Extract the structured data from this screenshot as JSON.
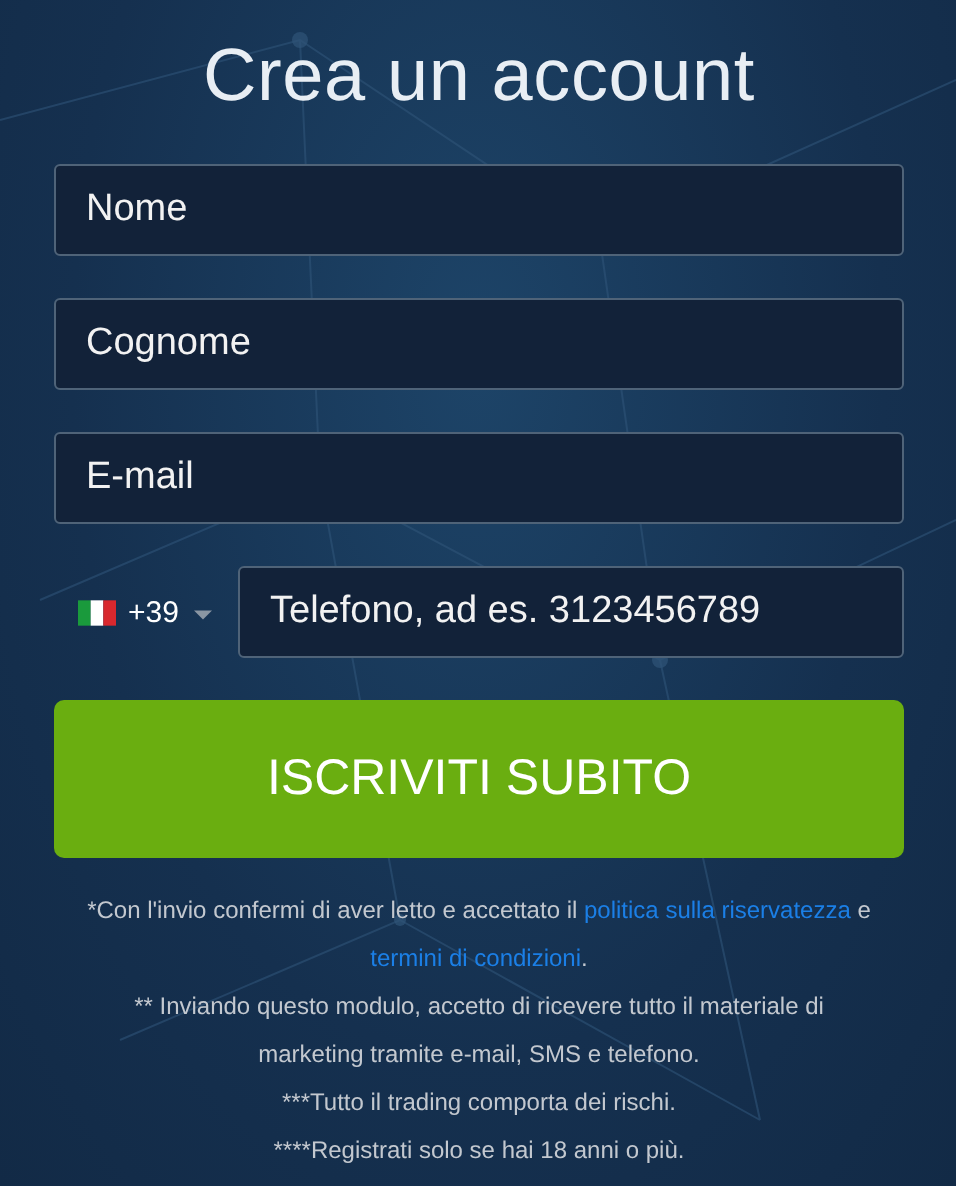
{
  "title": "Crea un account",
  "fields": [
    {
      "placeholder": "Nome"
    },
    {
      "placeholder": "Cognome"
    },
    {
      "placeholder": "E-mail"
    }
  ],
  "phone": {
    "country_code": "+39",
    "placeholder": "Telefono, ad es. 3123456789"
  },
  "submit_button": "ISCRIVITI SUBITO",
  "notes": [
    {
      "segments": [
        {
          "kind": "text",
          "text": "*Con l'invio confermi di aver letto e accettato il "
        },
        {
          "kind": "link",
          "text": "politica sulla riservatezza"
        },
        {
          "kind": "text",
          "text": " e "
        },
        {
          "kind": "link",
          "text": "termini di condizioni"
        },
        {
          "kind": "text",
          "text": "."
        }
      ]
    },
    {
      "segments": [
        {
          "kind": "text",
          "text": "** Inviando questo modulo, accetto di ricevere tutto il materiale di marketing tramite e-mail, SMS e telefono."
        }
      ]
    },
    {
      "segments": [
        {
          "kind": "text",
          "text": "***Tutto il trading comporta dei rischi."
        }
      ]
    },
    {
      "segments": [
        {
          "kind": "text",
          "text": "****Registrati solo se hai 18 anni o più."
        }
      ]
    }
  ]
}
